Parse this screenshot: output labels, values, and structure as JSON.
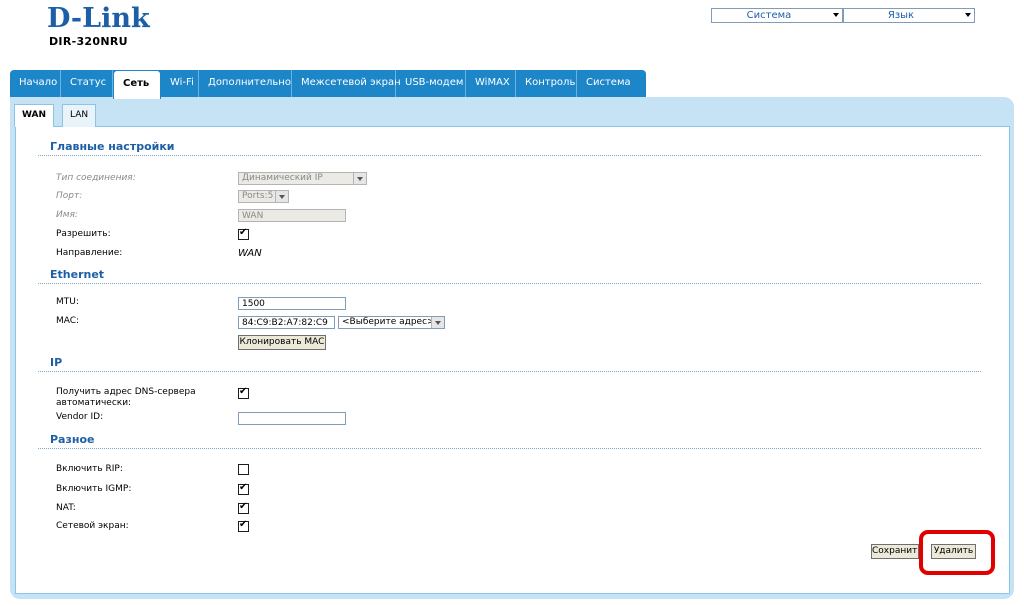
{
  "header": {
    "logo_text": "D-Link",
    "model": "DIR-320NRU",
    "system_select": "Система",
    "language_select": "Язык"
  },
  "tabs": [
    {
      "label": "Начало"
    },
    {
      "label": "Статус"
    },
    {
      "label": "Сеть"
    },
    {
      "label": "Wi-Fi"
    },
    {
      "label": "Дополнительно"
    },
    {
      "label": "Межсетевой экран"
    },
    {
      "label": "USB-модем"
    },
    {
      "label": "WiMAX"
    },
    {
      "label": "Контроль"
    },
    {
      "label": "Система"
    }
  ],
  "subtabs": {
    "wan": "WAN",
    "lan": "LAN"
  },
  "main_settings": {
    "title": "Главные настройки",
    "connection_type_label": "Тип соединения:",
    "connection_type_value": "Динамический IP",
    "port_label": "Порт:",
    "port_value": "Ports:5",
    "name_label": "Имя:",
    "name_value": "WAN",
    "enable_label": "Разрешить:",
    "enable_checked": true,
    "direction_label": "Направление:",
    "direction_value": "WAN"
  },
  "ethernet": {
    "title": "Ethernet",
    "mtu_label": "MTU:",
    "mtu_value": "1500",
    "mac_label": "MAC:",
    "mac_value": "84:C9:B2:A7:82:C9",
    "mac_select": "<Выберите адрес>",
    "clone_button": "Клонировать MAC"
  },
  "ip": {
    "title": "IP",
    "dns_auto_label_line1": "Получить адрес DNS-сервера",
    "dns_auto_label_line2": "автоматически:",
    "dns_auto_checked": true,
    "vendor_label": "Vendor ID:",
    "vendor_value": ""
  },
  "misc": {
    "title": "Разное",
    "rip_label": "Включить RIP:",
    "rip_checked": false,
    "igmp_label": "Включить IGMP:",
    "igmp_checked": true,
    "nat_label": "NAT:",
    "nat_checked": true,
    "firewall_label": "Сетевой экран:",
    "firewall_checked": true
  },
  "actions": {
    "save": "Сохранить",
    "delete": "Удалить"
  },
  "colors": {
    "brand": "#1d5fa6",
    "tabbar": "#1c86c8",
    "panel": "#c6e3f5",
    "highlight": "#e00000"
  }
}
